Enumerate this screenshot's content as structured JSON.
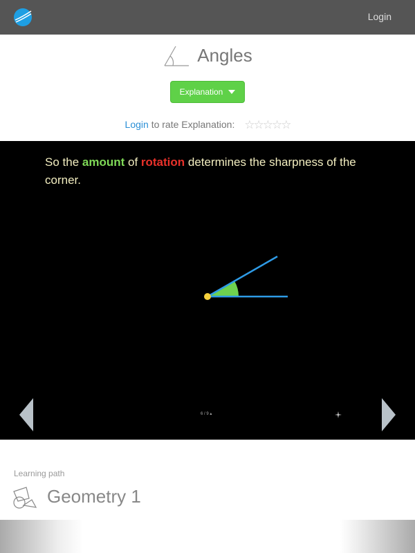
{
  "header": {
    "login_label": "Login"
  },
  "lesson": {
    "title": "Angles",
    "mode_label": "Explanation"
  },
  "rating": {
    "login_label": "Login",
    "text": "to rate Explanation:",
    "stars": "☆☆☆☆☆",
    "max": 5,
    "value": 0
  },
  "slide": {
    "caption_pre": "So the ",
    "caption_amount": "amount",
    "caption_mid": " of ",
    "caption_rotation": "rotation",
    "caption_post": " determines the sharpness of the corner.",
    "pager": "6 / 9",
    "colors": {
      "ray": "#2e9be6",
      "wedge": "#6fd24f",
      "vertex": "#f7d13c"
    }
  },
  "learning_path": {
    "label": "Learning path",
    "title": "Geometry 1"
  }
}
